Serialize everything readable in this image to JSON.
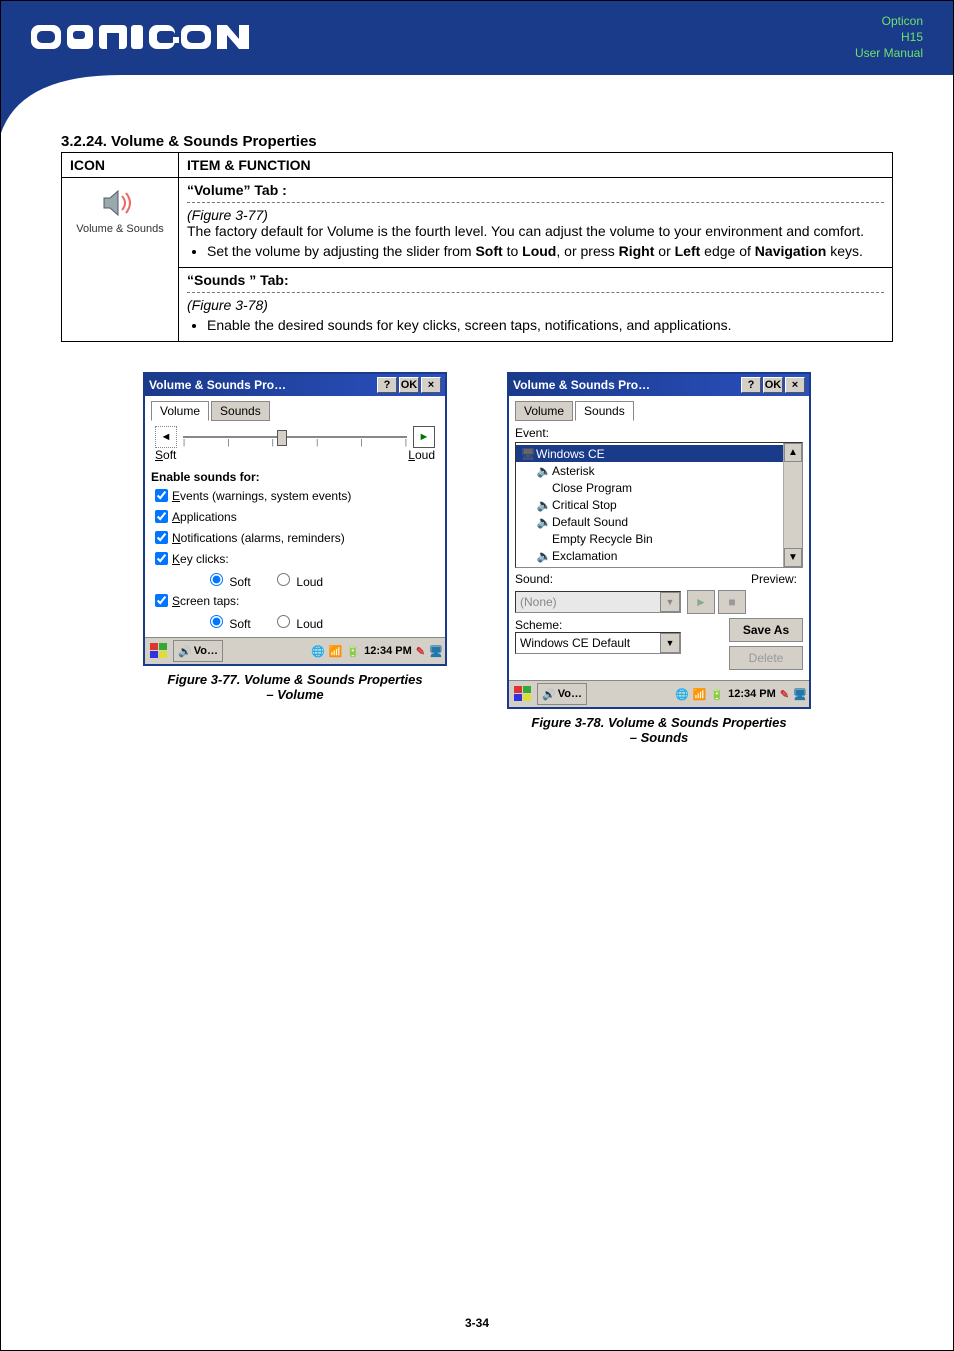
{
  "header": {
    "brand_line1": "Opticon",
    "brand_line2": "H15",
    "brand_line3": "User Manual"
  },
  "section": {
    "number": "3.2.24.",
    "title": "Volume & Sounds Properties"
  },
  "table": {
    "headers": {
      "icon": "ICON",
      "item": "ITEM & FUNCTION"
    },
    "icon_label": "Volume & Sounds",
    "volume_tab_header_pre": "“",
    "volume_tab_header_bold": "Volume",
    "volume_tab_header_post": "” Tab :",
    "volume_fig_ref": "(Figure 3-77)",
    "volume_body": "The factory default for Volume is the fourth level. You can adjust the volume to your environment and comfort.",
    "volume_bullet_pre": "Set the volume by adjusting the slider from ",
    "volume_bullet_soft": "Soft",
    "volume_bullet_to": " to ",
    "volume_bullet_loud": "Loud",
    "volume_bullet_or": ", or press ",
    "volume_bullet_right": "Right",
    "volume_bullet_orw": " or ",
    "volume_bullet_left": "Left",
    "volume_bullet_rest_pre": " edge of ",
    "volume_bullet_nav": "Navigation",
    "volume_bullet_rest_post": " keys.",
    "sounds_tab_header_pre": "“",
    "sounds_tab_header_bold": "Sounds ",
    "sounds_tab_header_post": "” Tab:",
    "sounds_fig_ref": "(Figure 3-78)",
    "sounds_bullet": "Enable the desired sounds for key clicks, screen taps, notifications, and applications."
  },
  "win_volume": {
    "title": "Volume & Sounds Pro…",
    "btn_help": "?",
    "btn_ok": "OK",
    "btn_close": "×",
    "tab_volume": "Volume",
    "tab_sounds": "Sounds",
    "slider_soft": "Soft",
    "slider_loud": "Loud",
    "enable_heading": "Enable sounds for:",
    "chk_events": "Events (warnings, system events)",
    "chk_apps": "Applications",
    "chk_notif": "Notifications (alarms, reminders)",
    "chk_key": "Key clicks:",
    "chk_screen": "Screen taps:",
    "radio_soft": "Soft",
    "radio_loud": "Loud",
    "chk_events_u": "E",
    "chk_apps_u": "A",
    "chk_notif_u": "N",
    "chk_key_u": "K",
    "chk_screen_u": "S",
    "slider_soft_u": "S",
    "slider_loud_u": "L",
    "taskbar_app": "Vo…",
    "taskbar_time": "12:34 PM"
  },
  "win_sounds": {
    "title": "Volume & Sounds Pro…",
    "btn_help": "?",
    "btn_ok": "OK",
    "btn_close": "×",
    "tab_volume": "Volume",
    "tab_sounds": "Sounds",
    "event_label": "Event:",
    "events": {
      "wince": "Windows CE",
      "asterisk": "Asterisk",
      "close": "Close Program",
      "critical": "Critical Stop",
      "defsound": "Default Sound",
      "empty": "Empty Recycle Bin",
      "excl": "Exclamation"
    },
    "sound_label": "Sound:",
    "preview_label": "Preview:",
    "sound_value": "(None)",
    "scheme_label": "Scheme:",
    "scheme_value": "Windows CE Default",
    "save_as": "Save As",
    "delete": "Delete",
    "taskbar_app": "Vo…",
    "taskbar_time": "12:34 PM"
  },
  "captions": {
    "fig77_line1": "Figure 3-77. Volume & Sounds Properties",
    "fig77_line2": "– Volume",
    "fig78_line1": "Figure 3-78. Volume & Sounds Properties",
    "fig78_line2": "– Sounds"
  },
  "footer": {
    "page": "3-34"
  }
}
